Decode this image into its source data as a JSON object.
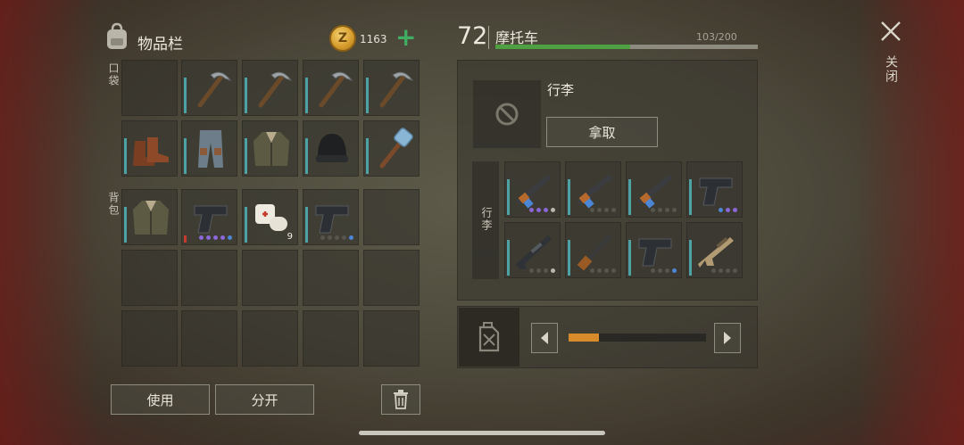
{
  "inventory": {
    "title": "物品栏",
    "coins": "1163",
    "coin_symbol": "Z",
    "add_symbol": "+",
    "pockets_label": "口袋",
    "backpack_label": "背包",
    "pockets": [
      {
        "item": "empty"
      },
      {
        "item": "pickaxe"
      },
      {
        "item": "pickaxe"
      },
      {
        "item": "pickaxe"
      },
      {
        "item": "pickaxe"
      },
      {
        "item": "boots"
      },
      {
        "item": "pants"
      },
      {
        "item": "jacket"
      },
      {
        "item": "beanie"
      },
      {
        "item": "sledgehammer"
      }
    ],
    "backpack": [
      {
        "item": "jacket"
      },
      {
        "item": "pistol",
        "dots": [
          "p",
          "p",
          "p",
          "p",
          "b"
        ]
      },
      {
        "item": "bandage",
        "qty": "9"
      },
      {
        "item": "pistol",
        "dots": [
          "g",
          "g",
          "g",
          "g",
          "b"
        ]
      }
    ],
    "use_button": "使用",
    "split_button": "分开"
  },
  "vehicle": {
    "level": "72",
    "name": "摩托车",
    "capacity_text": "103/200",
    "capacity_fraction": 0.515,
    "trunk_title": "行李",
    "take_button": "拿取",
    "trunk_label": "行李",
    "trunk_items": [
      {
        "item": "ak",
        "dots": [
          "p",
          "p",
          "p",
          "w"
        ]
      },
      {
        "item": "ak",
        "dots": [
          "g",
          "g",
          "g",
          "g"
        ]
      },
      {
        "item": "ak",
        "dots": [
          "g",
          "g",
          "g",
          "g"
        ]
      },
      {
        "item": "pistol",
        "dots": [
          "b",
          "p",
          "p"
        ]
      },
      {
        "item": "rifle",
        "dots": [
          "g",
          "g",
          "g",
          "w"
        ]
      },
      {
        "item": "shotgun",
        "dots": [
          "g",
          "g",
          "g",
          "g"
        ]
      },
      {
        "item": "pistol",
        "dots": [
          "g",
          "g",
          "g",
          "b"
        ]
      },
      {
        "item": "scar",
        "dots": [
          "g",
          "g",
          "g",
          "g"
        ]
      }
    ],
    "fuel_fraction": 0.22
  },
  "close_label": "关闭",
  "colors": {
    "condition_teal": "#4da2a6",
    "capacity_green": "#4fa043",
    "fuel_orange": "#d88b2b",
    "coin_plus_green": "#3fae63"
  }
}
